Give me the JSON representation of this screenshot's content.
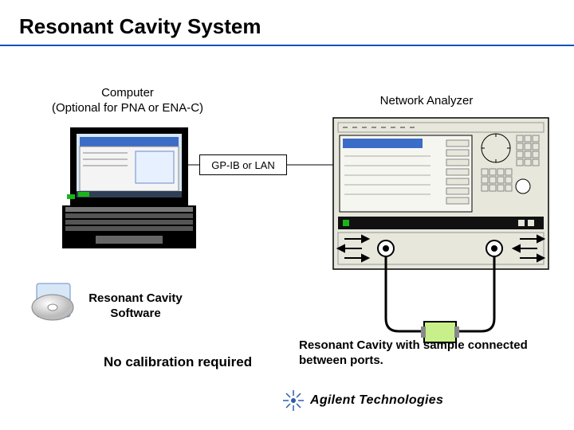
{
  "title": "Resonant Cavity System",
  "labels": {
    "computer": "Computer\n(Optional for PNA or ENA-C)",
    "analyzer": "Network Analyzer",
    "connection": "GP-IB or LAN",
    "software": "Resonant Cavity\nSoftware"
  },
  "captions": {
    "right": "Resonant Cavity with sample connected between ports.",
    "left": "No calibration required"
  },
  "brand": "Agilent Technologies"
}
